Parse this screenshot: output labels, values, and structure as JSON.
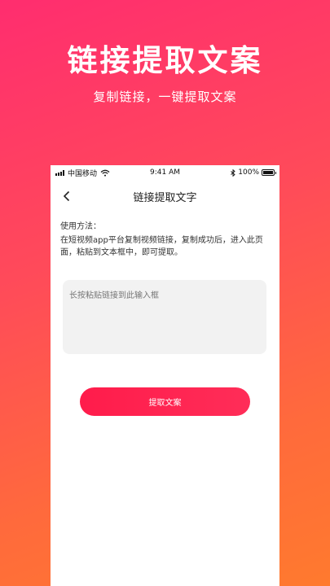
{
  "hero": {
    "title": "链接提取文案",
    "subtitle": "复制链接，一键提取文案"
  },
  "status_bar": {
    "carrier": "中国移动",
    "time": "9:41 AM",
    "battery": "100%",
    "icons": [
      "signal-icon",
      "wifi-icon",
      "bluetooth-icon",
      "battery-icon"
    ]
  },
  "nav": {
    "back_icon": "chevron-left-icon",
    "title": "链接提取文字"
  },
  "usage": {
    "title": "使用方法：",
    "text": "在短视频app平台复制视频链接，复制成功后，进入此页面，粘贴到文本框中，即可提取。"
  },
  "input": {
    "placeholder": "长按粘贴链接到此输入框",
    "value": ""
  },
  "action": {
    "extract_label": "提取文案"
  },
  "colors": {
    "gradient_top": "#ff2d6f",
    "gradient_bottom": "#ff7a2e",
    "button": "#ff1c4b"
  }
}
